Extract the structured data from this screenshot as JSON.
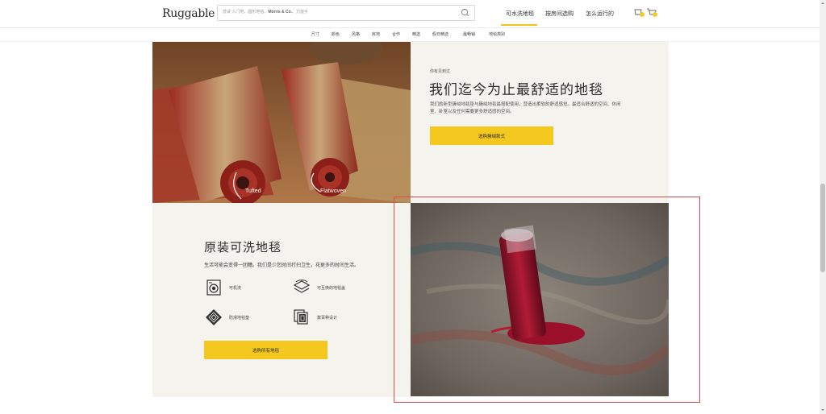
{
  "header": {
    "logo": "Ruggable",
    "search": {
      "placeholder_pre": "尝试 入门地、圆形地毯、",
      "placeholder_brand": "Morris & Co.",
      "placeholder_post": "、万能手"
    },
    "nav": [
      "可水洗地毯",
      "按房间选购",
      "怎么运行的"
    ],
    "active_nav_index": 0,
    "icons": [
      "search-icon",
      "wishlist-icon",
      "cart-icon"
    ]
  },
  "subnav": [
    "尺寸",
    "颜色",
    "风格",
    "房地",
    "合作",
    "精选",
    "假日精选",
    "最畅销",
    "地毯类别"
  ],
  "promo1": {
    "kicker": "你有见到过",
    "title": "我们迄今为止最舒适的地毯",
    "desc": "我们的新型簇绒地毯垫与簇绒地毯最搭配使用，营造出柔软的舒适感觉。最适合舒适的空间、休闲室、卧室以及任何需要更多舒适感的空间。",
    "cta": "选购簇绒款式",
    "photo_labels": [
      "Tufted",
      "Flatwoven"
    ]
  },
  "promo2": {
    "title": "原装可洗地毯",
    "subtitle": "生活可能会变得一团糟。我们是少您时间打扫卫生，花更多的时间生活。",
    "features": [
      {
        "label": "可机洗",
        "icon": "washing-machine-icon"
      },
      {
        "label": "可互换的地毯盖",
        "icon": "layers-icon"
      },
      {
        "label": "防滑地毯垫",
        "icon": "non-slip-pad-icon"
      },
      {
        "label": "数百种设计",
        "icon": "designs-icon"
      }
    ],
    "cta": "选购所有地毯"
  },
  "colors": {
    "accent": "#f5c81f",
    "section_bg": "#f4f3ee",
    "highlight": "#e0484a"
  }
}
